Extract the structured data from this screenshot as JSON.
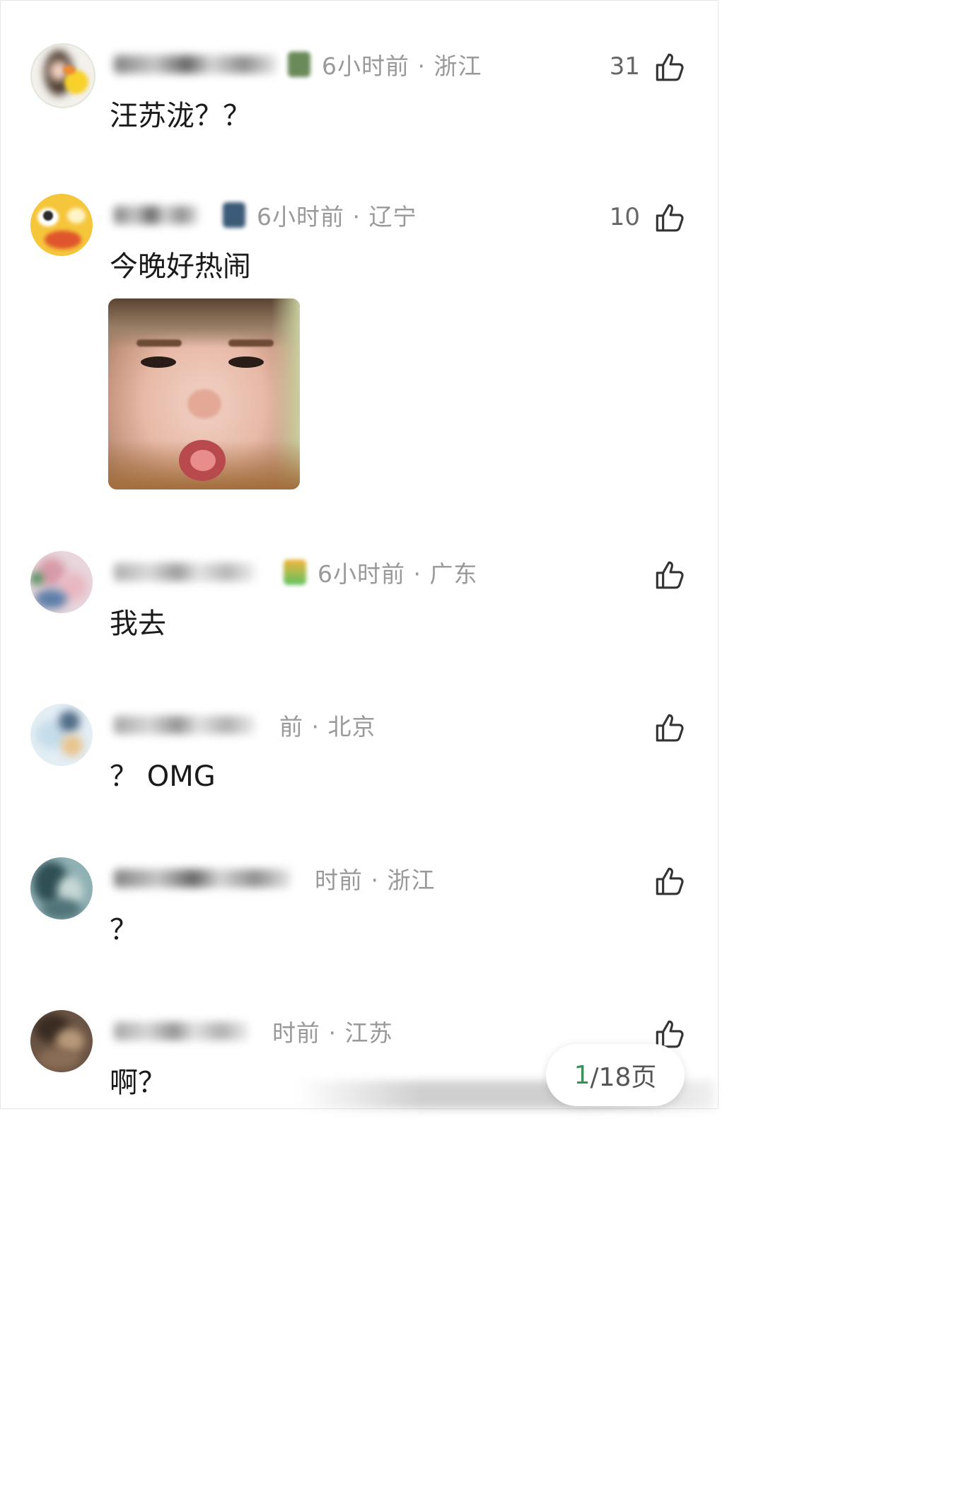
{
  "comments": [
    {
      "time_loc": "6小时前 · 浙江",
      "text": "汪苏泷？？",
      "likes": "31"
    },
    {
      "time_loc": "6小时前 · 辽宁",
      "text": "今晚好热闹",
      "likes": "10"
    },
    {
      "time_loc": "6小时前 · 广东",
      "text": "我去",
      "likes": ""
    },
    {
      "time_loc": "前 · 北京",
      "text": "？ OMG",
      "likes": ""
    },
    {
      "time_loc": "时前 · 浙江",
      "text": "？",
      "likes": ""
    },
    {
      "time_loc": "时前 · 江苏",
      "text": "啊？",
      "likes": ""
    }
  ],
  "pager": {
    "current": "1",
    "rest": "/18页"
  },
  "icons": {
    "like": "thumbs-up-icon"
  },
  "colors": {
    "meta": "#999999",
    "pager_current": "#3b8f5a",
    "text": "#1a1a1a"
  }
}
